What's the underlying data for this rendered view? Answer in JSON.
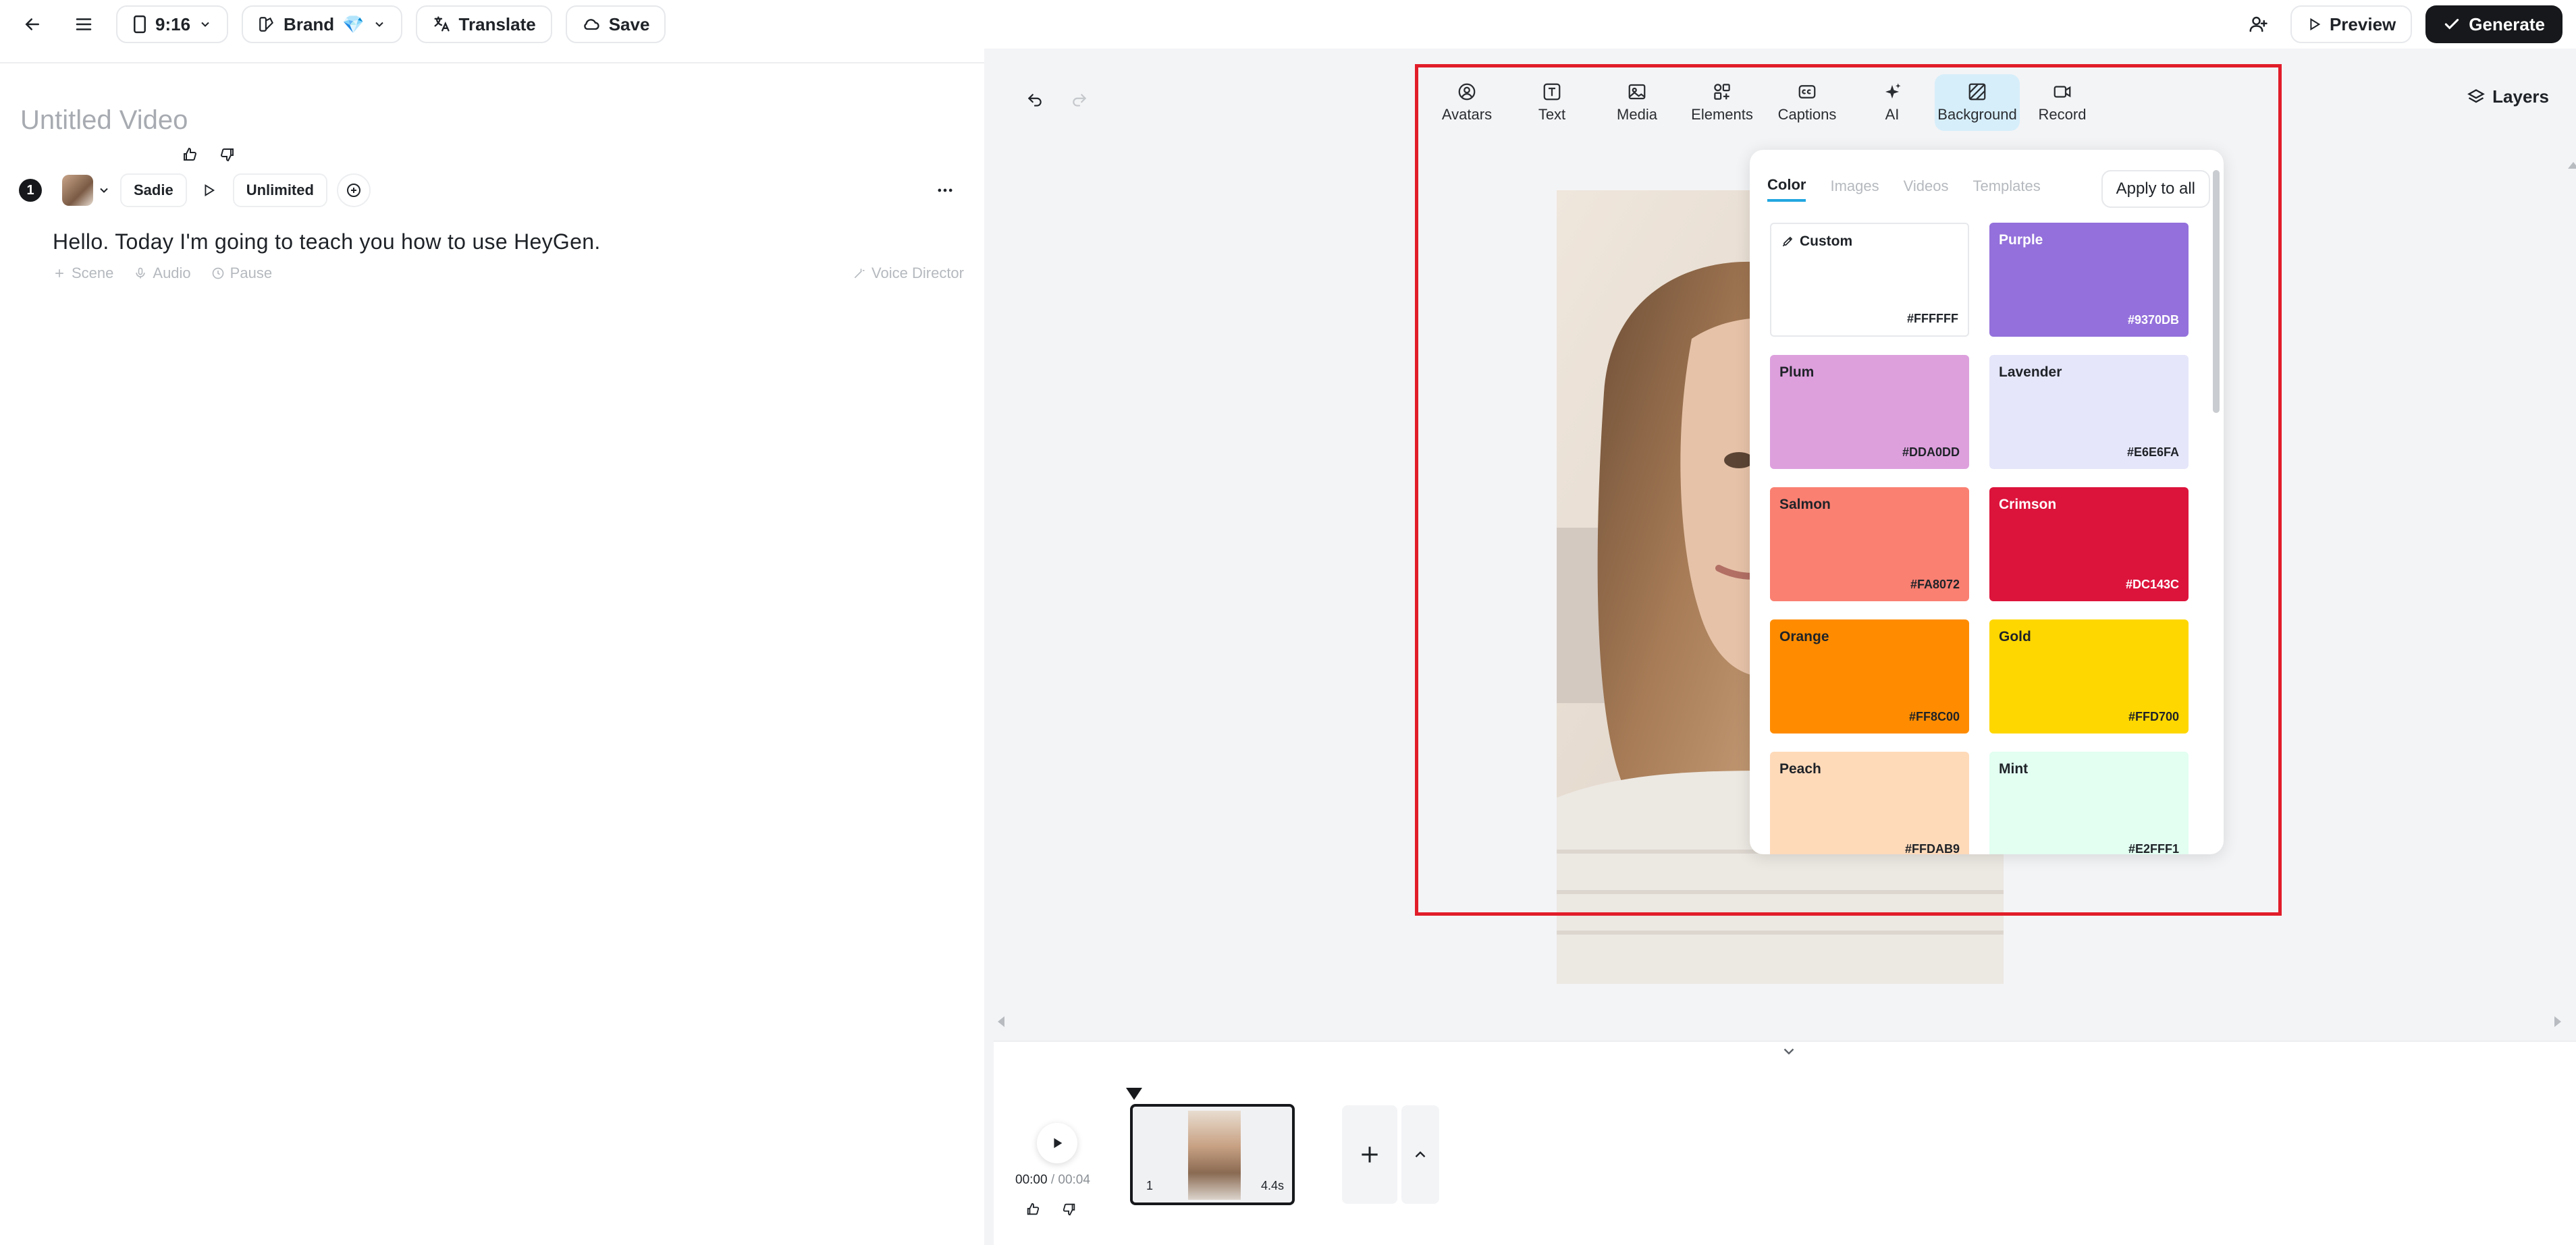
{
  "topbar": {
    "aspect_ratio": "9:16",
    "brand_label": "Brand",
    "brand_emoji": "💎",
    "translate_label": "Translate",
    "save_label": "Save",
    "preview_label": "Preview",
    "generate_label": "Generate"
  },
  "script": {
    "title": "Untitled Video",
    "scene_number": "1",
    "voice_name": "Sadie",
    "speed_label": "Unlimited",
    "text": "Hello. Today I'm going to teach you how to use HeyGen.",
    "tools": {
      "scene": "Scene",
      "audio": "Audio",
      "pause": "Pause",
      "voice_director": "Voice Director"
    }
  },
  "canvas": {
    "layers_label": "Layers",
    "toolbar": [
      {
        "label": "Avatars",
        "icon": "avatar-icon"
      },
      {
        "label": "Text",
        "icon": "text-icon"
      },
      {
        "label": "Media",
        "icon": "media-icon"
      },
      {
        "label": "Elements",
        "icon": "elements-icon"
      },
      {
        "label": "Captions",
        "icon": "captions-icon"
      },
      {
        "label": "AI",
        "icon": "ai-sparkle-icon"
      },
      {
        "label": "Background",
        "icon": "background-icon",
        "active": true
      },
      {
        "label": "Record",
        "icon": "record-icon"
      }
    ]
  },
  "background_panel": {
    "tabs": [
      "Color",
      "Images",
      "Videos",
      "Templates"
    ],
    "active_tab": "Color",
    "apply_all_label": "Apply to all",
    "swatches": [
      {
        "name": "Custom",
        "hex": "#FFFFFF",
        "color": "#FFFFFF"
      },
      {
        "name": "Purple",
        "hex": "#9370DB",
        "color": "#9370DB"
      },
      {
        "name": "Plum",
        "hex": "#DDA0DD",
        "color": "#DDA0DD"
      },
      {
        "name": "Lavender",
        "hex": "#E6E6FA",
        "color": "#E6E6FA"
      },
      {
        "name": "Salmon",
        "hex": "#FA8072",
        "color": "#FA8072"
      },
      {
        "name": "Crimson",
        "hex": "#DC143C",
        "color": "#DC143C"
      },
      {
        "name": "Orange",
        "hex": "#FF8C00",
        "color": "#FF8C00"
      },
      {
        "name": "Gold",
        "hex": "#FFD700",
        "color": "#FFD700"
      },
      {
        "name": "Peach",
        "hex": "#FFDAB9",
        "color": "#FFDAB9"
      },
      {
        "name": "Mint",
        "hex": "#E2FFF1",
        "color": "#E2FFF1"
      }
    ]
  },
  "timeline": {
    "current_time": "00:00",
    "separator": "/",
    "total_time": "00:04",
    "scene_number": "1",
    "scene_duration": "4.4s"
  },
  "colors": {
    "accent": "#22A7E0",
    "highlight": "#E11D2A",
    "active_tool_bg": "#D6EEFA"
  }
}
